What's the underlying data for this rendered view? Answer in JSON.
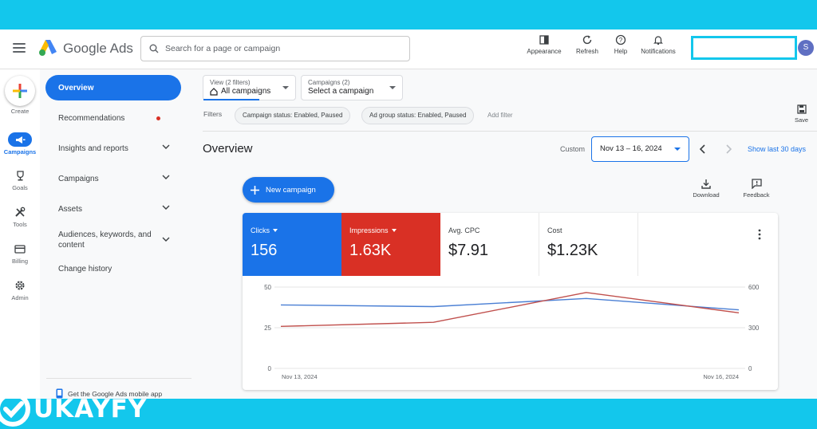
{
  "header": {
    "brand": "Google Ads",
    "search_placeholder": "Search for a page or campaign",
    "tools": [
      {
        "label": "Appearance",
        "icon": "appearance-icon"
      },
      {
        "label": "Refresh",
        "icon": "refresh-icon"
      },
      {
        "label": "Help",
        "icon": "help-icon"
      },
      {
        "label": "Notifications",
        "icon": "bell-icon"
      }
    ],
    "avatar_initial": "S"
  },
  "rail": {
    "create_label": "Create",
    "items": [
      {
        "label": "Campaigns",
        "icon": "megaphone-icon",
        "active": true
      },
      {
        "label": "Goals",
        "icon": "trophy-icon"
      },
      {
        "label": "Tools",
        "icon": "tools-icon"
      },
      {
        "label": "Billing",
        "icon": "card-icon"
      },
      {
        "label": "Admin",
        "icon": "gear-icon"
      }
    ]
  },
  "nav": {
    "items": [
      {
        "label": "Overview",
        "active": true
      },
      {
        "label": "Recommendations",
        "badge": true
      },
      {
        "label": "Insights and reports",
        "expandable": true
      },
      {
        "label": "Campaigns",
        "expandable": true
      },
      {
        "label": "Assets",
        "expandable": true
      },
      {
        "label": "Audiences, keywords, and content",
        "expandable": true
      },
      {
        "label": "Change history"
      }
    ],
    "footer": "Get the Google Ads mobile app"
  },
  "toolbar": {
    "view_small": "View (2 filters)",
    "view_value": "All campaigns",
    "campaigns_small": "Campaigns (2)",
    "campaigns_value": "Select a campaign",
    "filters_label": "Filters",
    "chips": [
      "Campaign status: Enabled, Paused",
      "Ad group status: Enabled, Paused"
    ],
    "add_filter": "Add filter",
    "save_label": "Save"
  },
  "overview": {
    "title": "Overview",
    "custom_label": "Custom",
    "date_range": "Nov 13 – 16, 2024",
    "show_last": "Show last 30 days",
    "new_campaign": "New campaign",
    "download": "Download",
    "feedback": "Feedback"
  },
  "metrics": [
    {
      "label": "Clicks",
      "value": "156",
      "color": "#1a73e8",
      "dropdown": true
    },
    {
      "label": "Impressions",
      "value": "1.63K",
      "color": "#d93025",
      "dropdown": true
    },
    {
      "label": "Avg. CPC",
      "value": "$7.91"
    },
    {
      "label": "Cost",
      "value": "$1.23K"
    }
  ],
  "chart_data": {
    "type": "line",
    "x": [
      "Nov 13, 2024",
      "Nov 14, 2024",
      "Nov 15, 2024",
      "Nov 16, 2024"
    ],
    "x_tick_labels": [
      "Nov 13, 2024",
      "Nov 16, 2024"
    ],
    "y_left_ticks": [
      "50",
      "25",
      "0"
    ],
    "y_right_ticks": [
      "600",
      "300",
      "0"
    ],
    "y_left_range": [
      0,
      50
    ],
    "y_right_range": [
      0,
      600
    ],
    "grid": true,
    "series": [
      {
        "name": "Clicks",
        "axis": "left",
        "color": "#4a7fd4",
        "values": [
          39,
          38,
          43,
          36
        ]
      },
      {
        "name": "Impressions",
        "axis": "right",
        "color": "#c0504d",
        "values": [
          310,
          340,
          560,
          410
        ]
      }
    ]
  },
  "watermark": "UKAYFY"
}
